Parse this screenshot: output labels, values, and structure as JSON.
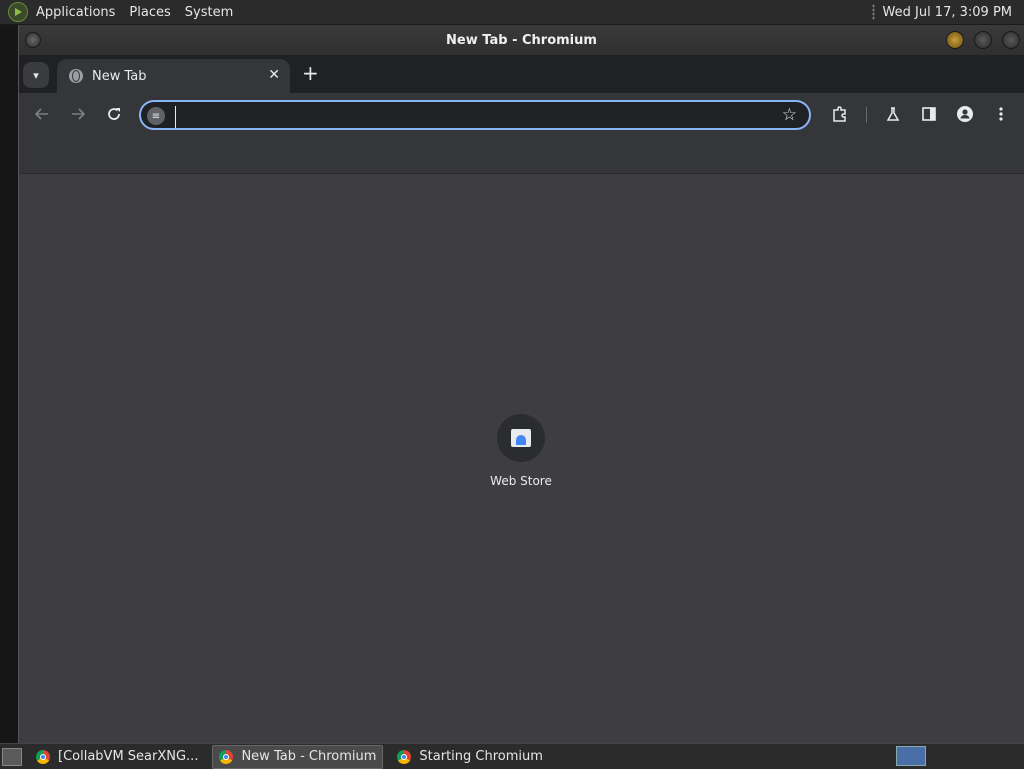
{
  "top_panel": {
    "menus": [
      "Applications",
      "Places",
      "System"
    ],
    "clock": "Wed Jul 17,  3:09 PM"
  },
  "window": {
    "title": "New Tab - Chromium"
  },
  "tabstrip": {
    "tab_label": "New Tab",
    "close_glyph": "✕",
    "new_tab_glyph": "+"
  },
  "toolbar": {
    "omnibox_value": "",
    "icons": [
      "back-icon",
      "forward-icon",
      "reload-icon",
      "bookmark-star-icon",
      "extensions-icon",
      "labs-icon",
      "side-panel-icon",
      "profile-icon",
      "menu-icon"
    ]
  },
  "content": {
    "shortcut_label": "Web Store"
  },
  "taskbar": {
    "tasks": [
      "[CollabVM SearXNG...",
      "New Tab - Chromium",
      "Starting Chromium"
    ]
  },
  "colors": {
    "accent": "#8ab4f8",
    "content_bg": "#3d3d42",
    "toolbar_bg": "#35363a"
  }
}
